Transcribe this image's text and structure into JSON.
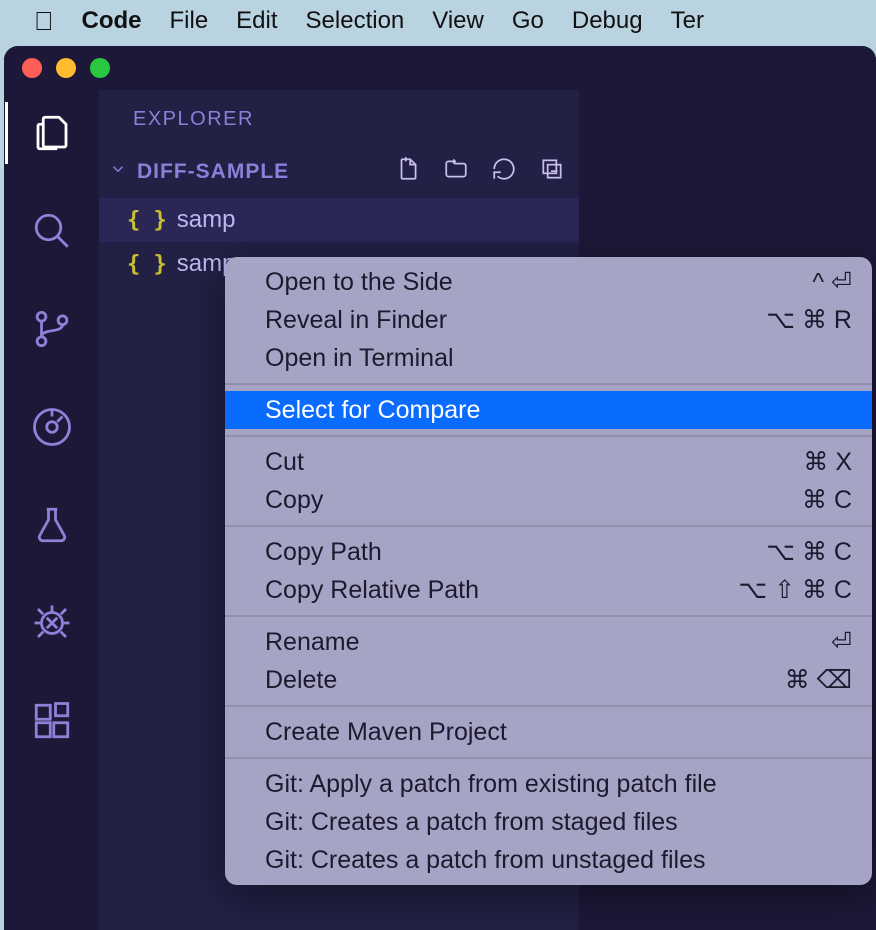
{
  "mac_menu": {
    "app_name": "Code",
    "items": [
      "File",
      "Edit",
      "Selection",
      "View",
      "Go",
      "Debug",
      "Ter"
    ]
  },
  "sidebar": {
    "title": "EXPLORER",
    "folder_name": "DIFF-SAMPLE",
    "files": [
      {
        "icon": "{ }",
        "name": "samp"
      },
      {
        "icon": "{ }",
        "name": "samp"
      }
    ]
  },
  "context_menu": {
    "groups": [
      [
        {
          "label": "Open to the Side",
          "shortcut": "^ ⏎"
        },
        {
          "label": "Reveal in Finder",
          "shortcut": "⌥ ⌘ R"
        },
        {
          "label": "Open in Terminal",
          "shortcut": ""
        }
      ],
      [
        {
          "label": "Select for Compare",
          "shortcut": "",
          "highlighted": true
        }
      ],
      [
        {
          "label": "Cut",
          "shortcut": "⌘ X"
        },
        {
          "label": "Copy",
          "shortcut": "⌘ C"
        }
      ],
      [
        {
          "label": "Copy Path",
          "shortcut": "⌥ ⌘ C"
        },
        {
          "label": "Copy Relative Path",
          "shortcut": "⌥ ⇧ ⌘ C"
        }
      ],
      [
        {
          "label": "Rename",
          "shortcut": "⏎"
        },
        {
          "label": "Delete",
          "shortcut": "⌘ ⌫"
        }
      ],
      [
        {
          "label": "Create Maven Project",
          "shortcut": ""
        }
      ],
      [
        {
          "label": "Git: Apply a patch from existing patch file",
          "shortcut": ""
        },
        {
          "label": "Git: Creates a patch from staged files",
          "shortcut": ""
        },
        {
          "label": "Git: Creates a patch from unstaged files",
          "shortcut": ""
        }
      ]
    ]
  }
}
